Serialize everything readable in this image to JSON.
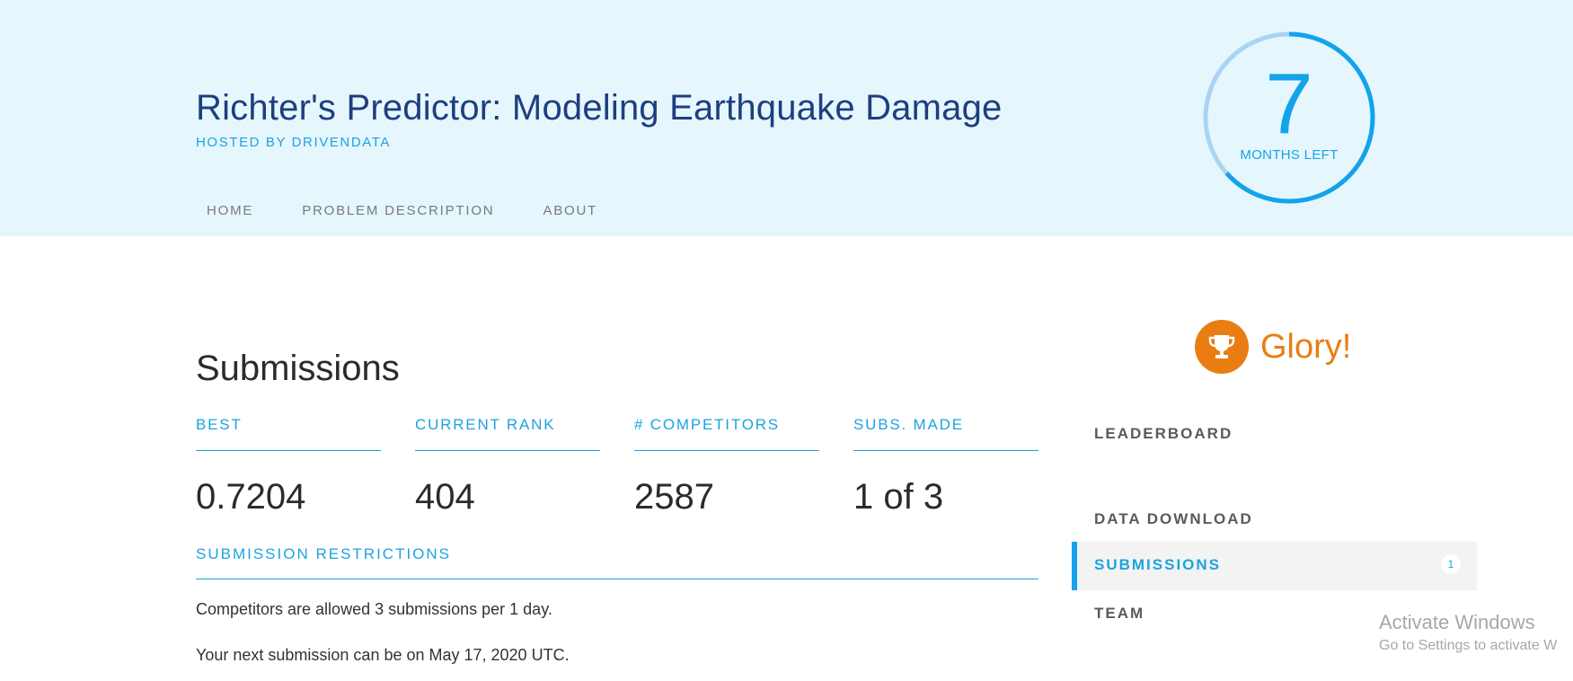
{
  "header": {
    "title": "Richter's Predictor: Modeling Earthquake Damage",
    "hosted_by": "HOSTED BY DRIVENDATA",
    "nav": [
      {
        "label": "HOME"
      },
      {
        "label": "PROBLEM DESCRIPTION"
      },
      {
        "label": "ABOUT"
      }
    ],
    "countdown": {
      "value": "7",
      "label": "MONTHS LEFT"
    }
  },
  "main": {
    "title": "Submissions",
    "stats": [
      {
        "label": "BEST",
        "value": "0.7204"
      },
      {
        "label": "CURRENT RANK",
        "value": "404"
      },
      {
        "label": "# COMPETITORS",
        "value": "2587"
      },
      {
        "label": "SUBS. MADE",
        "value": "1 of 3"
      }
    ],
    "restrictions": {
      "heading": "SUBMISSION RESTRICTIONS",
      "line1": "Competitors are allowed 3 submissions per 1 day.",
      "line2": "Your next submission can be on May 17, 2020 UTC."
    }
  },
  "sidebar": {
    "prize": {
      "icon": "trophy-icon",
      "label": "Glory!"
    },
    "links": [
      {
        "label": "LEADERBOARD"
      },
      {
        "label": "DATA DOWNLOAD"
      },
      {
        "label": "SUBMISSIONS",
        "badge": "1",
        "active": true
      },
      {
        "label": "TEAM"
      }
    ]
  },
  "watermark": {
    "line1": "Activate Windows",
    "line2": "Go to Settings to activate W"
  },
  "colors": {
    "header_bg": "#e6f6fd",
    "title": "#1d3f80",
    "accent": "#1ca3e0",
    "orange": "#ea7d12",
    "active_bg": "#f3f3f3"
  }
}
